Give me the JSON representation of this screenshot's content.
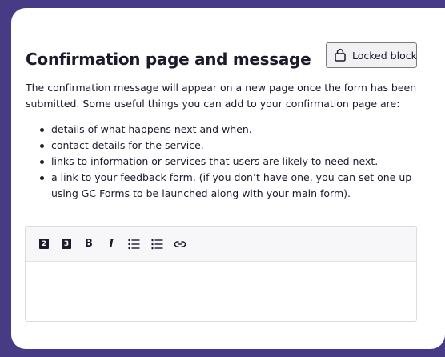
{
  "section": {
    "title": "Confirmation page and message",
    "locked_label": "Locked block",
    "description": "The confirmation message will appear on a new page once the form has been submitted. Some useful things you can add to your confirmation page are:",
    "bullets": [
      "details of what happens next and when.",
      "contact details for the service.",
      "links to information or services that users are likely to need next.",
      "a link to your feedback form. (if you don’t have one, you can set one up using GC Forms to be launched along with your main form)."
    ]
  },
  "editor": {
    "toolbar": {
      "h2_label": "2",
      "h3_label": "3",
      "bold_label": "B",
      "italic_label": "I"
    },
    "content": ""
  },
  "colors": {
    "frame": "#463b84",
    "text": "#1c1a2b"
  }
}
